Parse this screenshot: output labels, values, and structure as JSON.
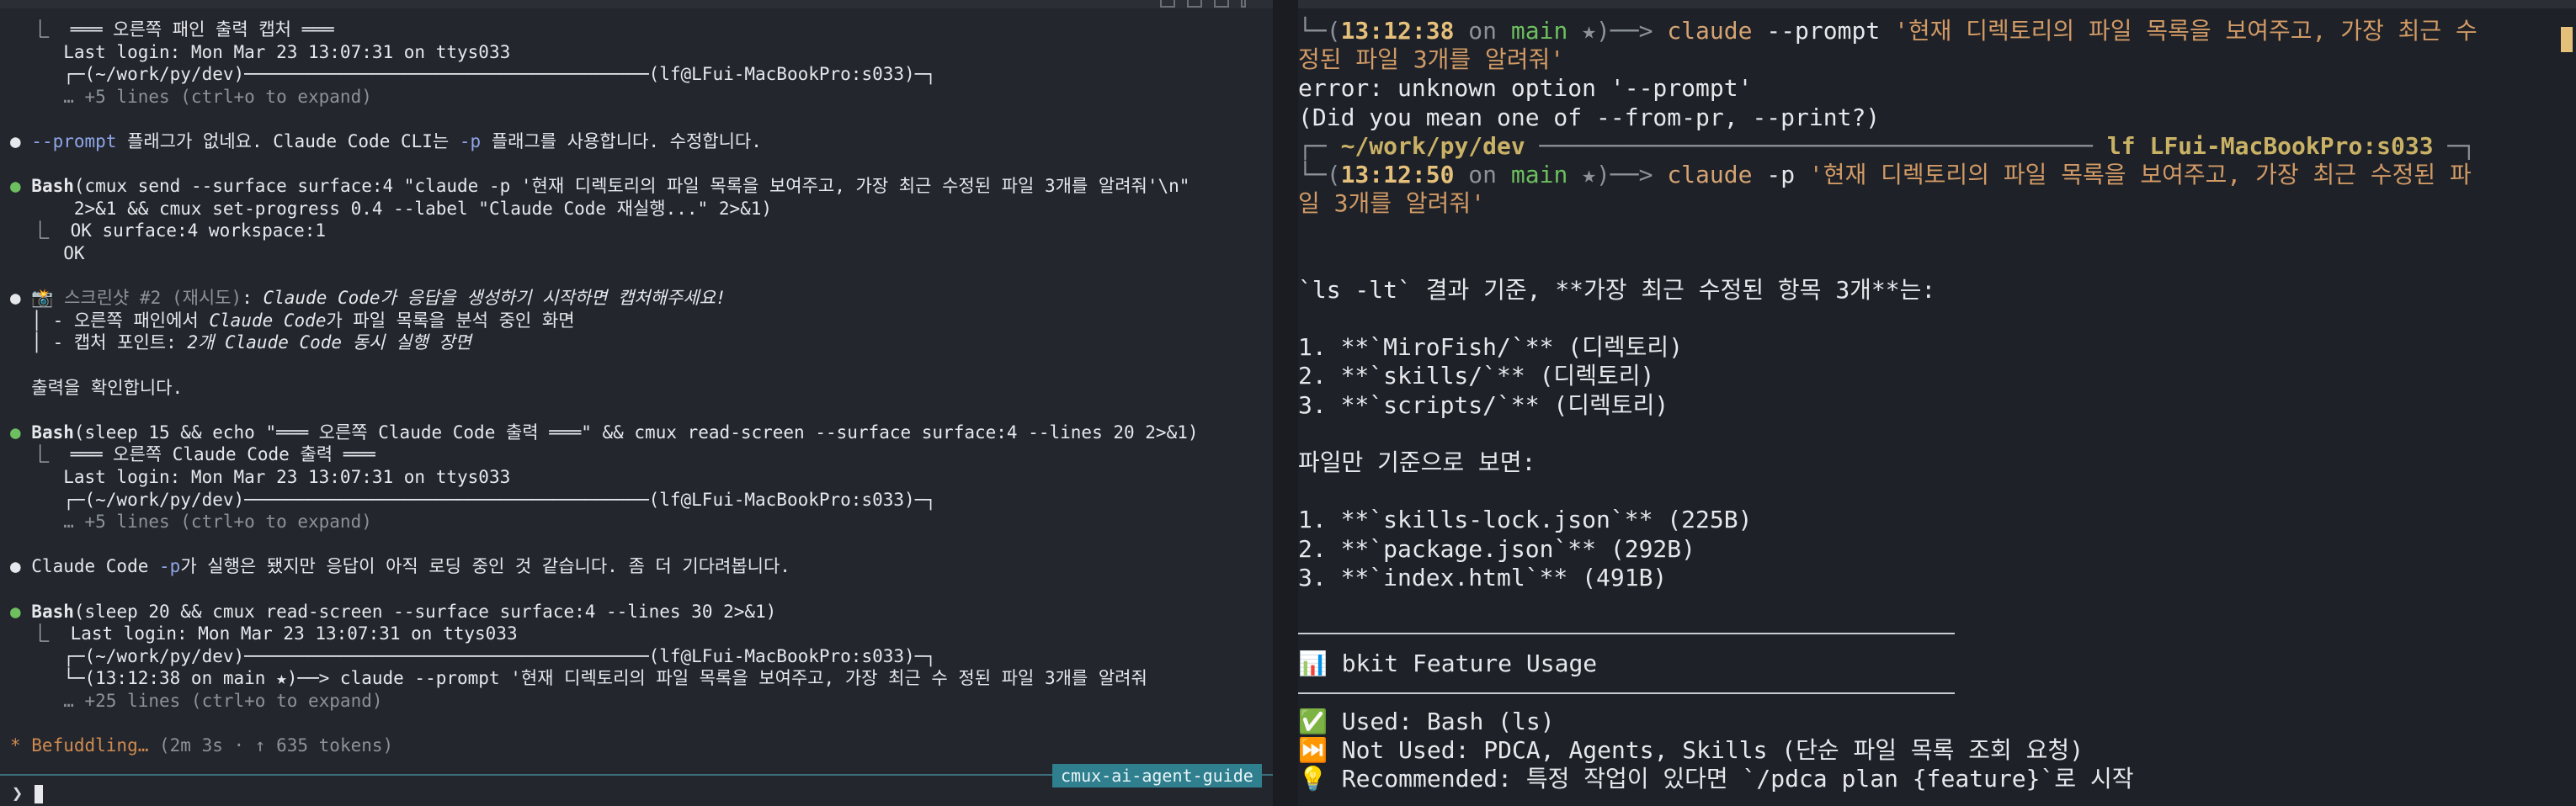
{
  "left": {
    "lines": [
      [
        {
          "t": "  ⎿  ═══ 오른쪽 패인 출력 캡처 ═══",
          "c": "white"
        }
      ],
      [
        {
          "t": "     Last login: Mon Mar 23 13:07:31 on ttys033",
          "c": "white"
        }
      ],
      [
        {
          "t": "     ┌─(~/work/py/dev)──────────────────────────────────────(lf@LFui-MacBookPro:s033)─┐",
          "c": "white"
        }
      ],
      [
        {
          "t": "     … +5 lines (ctrl+o to expand)",
          "c": "dim"
        }
      ],
      [],
      [
        {
          "t": "● ",
          "c": "white"
        },
        {
          "t": "--prompt",
          "c": "blue"
        },
        {
          "t": " 플래그가 없네요. Claude Code CLI는 ",
          "c": "white"
        },
        {
          "t": "-p",
          "c": "blue"
        },
        {
          "t": " 플래그를 사용합니다. 수정합니다.",
          "c": "white"
        }
      ],
      [],
      [
        {
          "t": "● ",
          "c": "green"
        },
        {
          "t": "Bash",
          "c": "white b"
        },
        {
          "t": "(cmux send --surface surface:4 \"claude -p '현재 디렉토리의 파일 목록을 보여주고, 가장 최근 수정된 파일 3개를 알려줘'\\n\"",
          "c": "white"
        }
      ],
      [
        {
          "t": "      2>&1 && cmux set-progress 0.4 --label \"Claude Code 재실행...\" 2>&1)",
          "c": "white"
        }
      ],
      [
        {
          "t": "  ⎿  OK surface:4 workspace:1",
          "c": "white"
        }
      ],
      [
        {
          "t": "     OK",
          "c": "white"
        }
      ],
      [],
      [
        {
          "t": "● ",
          "c": "white"
        },
        {
          "t": "📸 스크린샷 #2 (재시도)",
          "c": "dim"
        },
        {
          "t": ": ",
          "c": "white"
        },
        {
          "t": "Claude Code",
          "c": "white i"
        },
        {
          "t": "가 응답을 생성하기 시작하면 캡처해주세요!",
          "c": "white i"
        }
      ],
      [
        {
          "t": "  │ - 오른쪽 패인에서 ",
          "c": "white"
        },
        {
          "t": "Claude Code",
          "c": "white i"
        },
        {
          "t": "가 파일 목록을 분석 중인 화면",
          "c": "white"
        }
      ],
      [
        {
          "t": "  │ - 캡처 포인트: ",
          "c": "white"
        },
        {
          "t": "2개 Claude Code 동시 실행 장면",
          "c": "white i"
        }
      ],
      [],
      [
        {
          "t": "  출력을 확인합니다.",
          "c": "white"
        }
      ],
      [],
      [
        {
          "t": "● ",
          "c": "green"
        },
        {
          "t": "Bash",
          "c": "white b"
        },
        {
          "t": "(sleep 15 && echo \"═══ 오른쪽 Claude Code 출력 ═══\" && cmux read-screen --surface surface:4 --lines 20 2>&1)",
          "c": "white"
        }
      ],
      [
        {
          "t": "  ⎿  ═══ 오른쪽 Claude Code 출력 ═══",
          "c": "white"
        }
      ],
      [
        {
          "t": "     Last login: Mon Mar 23 13:07:31 on ttys033",
          "c": "white"
        }
      ],
      [
        {
          "t": "     ┌─(~/work/py/dev)──────────────────────────────────────(lf@LFui-MacBookPro:s033)─┐",
          "c": "white"
        }
      ],
      [
        {
          "t": "     … +5 lines (ctrl+o to expand)",
          "c": "dim"
        }
      ],
      [],
      [
        {
          "t": "● Claude Code ",
          "c": "white"
        },
        {
          "t": "-p",
          "c": "blue"
        },
        {
          "t": "가 실행은 됐지만 응답이 아직 로딩 중인 것 같습니다. 좀 더 기다려봅니다.",
          "c": "white"
        }
      ],
      [],
      [
        {
          "t": "● ",
          "c": "green"
        },
        {
          "t": "Bash",
          "c": "white b"
        },
        {
          "t": "(sleep 20 && cmux read-screen --surface surface:4 --lines 30 2>&1)",
          "c": "white"
        }
      ],
      [
        {
          "t": "  ⎿  Last login: Mon Mar 23 13:07:31 on ttys033",
          "c": "white"
        }
      ],
      [
        {
          "t": "     ┌─(~/work/py/dev)──────────────────────────────────────(lf@LFui-MacBookPro:s033)─┐",
          "c": "white"
        }
      ],
      [
        {
          "t": "     └─(13:12:38 on main ★)──> claude --prompt '현재 디렉토리의 파일 목록을 보여주고, 가장 최근 수 정된 파일 3개를 알려줘",
          "c": "white"
        }
      ],
      [
        {
          "t": "     … +25 lines (ctrl+o to expand)",
          "c": "dim"
        }
      ],
      [],
      [
        {
          "t": "* Befuddling… ",
          "c": "orange"
        },
        {
          "t": "(2m 3s · ↑ 635 tokens)",
          "c": "dim"
        }
      ]
    ],
    "session_tag": "cmux-ai-agent-guide",
    "prompt_symbol": "❯"
  },
  "right": {
    "lines": [
      [
        {
          "t": "└─(",
          "c": "dim"
        },
        {
          "t": "13:12:38",
          "c": "yellow b"
        },
        {
          "t": " on ",
          "c": "dim"
        },
        {
          "t": "main",
          "c": "green"
        },
        {
          "t": " ★",
          "c": "dim"
        },
        {
          "t": ")──> ",
          "c": "dim"
        },
        {
          "t": "claude",
          "c": "cmd"
        },
        {
          "t": " --prompt ",
          "c": "white"
        },
        {
          "t": "'현재 디렉토리의 파일 목록을 보여주고, 가장 최근 수",
          "c": "str"
        }
      ],
      [
        {
          "t": "정된 파일 3개를 알려줘'",
          "c": "str"
        }
      ],
      [
        {
          "t": "error: unknown option '--prompt'",
          "c": "white"
        }
      ],
      [
        {
          "t": "(Did you mean one of --from-pr, --print?)",
          "c": "white"
        }
      ],
      [
        {
          "t": "┌─ ",
          "c": "dim"
        },
        {
          "t": "~/work/py/dev",
          "c": "gold b"
        },
        {
          "t": " ─────────────────────────────────────── ",
          "c": "dim"
        },
        {
          "t": "lf LFui-MacBookPro:s033",
          "c": "gold b"
        },
        {
          "t": " ─┐",
          "c": "dim"
        }
      ],
      [
        {
          "t": "└─(",
          "c": "dim"
        },
        {
          "t": "13:12:50",
          "c": "yellow b"
        },
        {
          "t": " on ",
          "c": "dim"
        },
        {
          "t": "main",
          "c": "green"
        },
        {
          "t": " ★",
          "c": "dim"
        },
        {
          "t": ")──> ",
          "c": "dim"
        },
        {
          "t": "claude",
          "c": "cmd"
        },
        {
          "t": " -p ",
          "c": "white"
        },
        {
          "t": "'현재 디렉토리의 파일 목록을 보여주고, 가장 최근 수정된 파",
          "c": "str"
        }
      ],
      [
        {
          "t": "일 3개를 알려줘'",
          "c": "str"
        }
      ],
      [],
      [],
      [
        {
          "t": "`ls -lt` 결과 기준, **가장 최근 수정된 항목 3개**는:",
          "c": "white"
        }
      ],
      [],
      [
        {
          "t": "1. **`MiroFish/`** (디렉토리)",
          "c": "white"
        }
      ],
      [
        {
          "t": "2. **`skills/`** (디렉토리)",
          "c": "white"
        }
      ],
      [
        {
          "t": "3. **`scripts/`** (디렉토리)",
          "c": "white"
        }
      ],
      [],
      [
        {
          "t": "파일만 기준으로 보면:",
          "c": "white"
        }
      ],
      [],
      [
        {
          "t": "1. **`skills-lock.json`** (225B)",
          "c": "white"
        }
      ],
      [
        {
          "t": "2. **`package.json`** (292B)",
          "c": "white"
        }
      ],
      [
        {
          "t": "3. **`index.html`** (491B)",
          "c": "white"
        }
      ],
      [],
      [],
      [
        {
          "t": "📊 bkit Feature Usage",
          "c": "white"
        }
      ],
      [],
      [
        {
          "t": "✅ Used: Bash (ls)",
          "c": "white"
        }
      ],
      [
        {
          "t": "⏭️ Not Used: PDCA, Agents, Skills (단순 파일 목록 조회 요청)",
          "c": "white"
        }
      ],
      [
        {
          "t": "💡 Recommended: 특정 작업이 있다면 `/pdca plan {feature}`로 시작",
          "c": "white"
        }
      ]
    ]
  }
}
